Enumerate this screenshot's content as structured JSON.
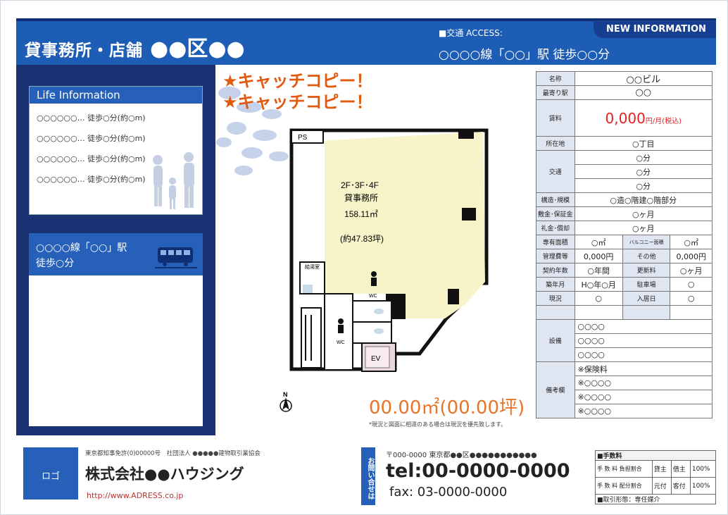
{
  "header": {
    "title": "貸事務所・店舗",
    "ward": "●●区●●",
    "access_label": "■交通 ACCESS:",
    "access_value": "○○○○線「○○」駅 徒歩○○分",
    "new_info": "NEW INFORMATION"
  },
  "life": {
    "title": "Life Information",
    "items": [
      "○○○○○○…  徒歩○分(約○m)",
      "○○○○○○…  徒歩○分(約○m)",
      "○○○○○○…  徒歩○分(約○m)",
      "○○○○○○…  徒歩○分(約○m)"
    ]
  },
  "access_box": {
    "line1": "○○○○線「○○」駅",
    "line2": "徒歩○分"
  },
  "catchcopy": [
    "★キャッチコピー！",
    "★キャッチコピー！"
  ],
  "floorplan": {
    "ps": "PS",
    "floors": "2F･3F･4F",
    "use": "貸事務所",
    "area": "158.11㎡",
    "tsubo": "(約47.83坪)",
    "kyuto": "給湯室",
    "wc": "WC",
    "ev": "EV",
    "north": "N"
  },
  "area_price": "00.00㎡(00.00坪)",
  "note": "*現況と図面に相違のある場合は現況を優先致します。",
  "spec": {
    "name_k": "名称",
    "name_v": "○○ビル",
    "station_k": "最寄り駅",
    "station_v": "○○",
    "rent_k": "賃料",
    "rent_v": "0,000",
    "rent_unit": "円/月(税込)",
    "loc_k": "所在地",
    "loc_v": "○丁目",
    "transit_k": "交通",
    "transit_v": [
      "○分",
      "○分",
      "○分"
    ],
    "struct_k": "構造･規模",
    "struct_v": "○造○階建○階部分",
    "deposit_k": "敷金･保証金",
    "deposit_v": "○ヶ月",
    "key_k": "礼金･償却",
    "key_v": "○ヶ月",
    "exclusive_k": "専有面積",
    "exclusive_v": "○㎡",
    "balcony_k": "バルコニー面積",
    "balcony_v": "○㎡",
    "mgmt_k": "管理費等",
    "mgmt_v": "0,000円",
    "other_k": "その他",
    "other_v": "0,000円",
    "term_k": "契約年数",
    "term_v": "○年間",
    "renew_k": "更新料",
    "renew_v": "○ヶ月",
    "built_k": "築年月",
    "built_v": "H○年○月",
    "parking_k": "駐車場",
    "parking_v": "○",
    "status_k": "現況",
    "status_v": "○",
    "move_k": "入居日",
    "move_v": "○",
    "equip_k": "設備",
    "equip_v": [
      "○○○○",
      "○○○○",
      "○○○○"
    ],
    "remarks_k": "備考欄",
    "remarks_v": [
      "※保険料",
      "※○○○○",
      "※○○○○",
      "※○○○○"
    ]
  },
  "footer": {
    "logo": "ロゴ",
    "license": "東京都知事免許(0)00000号　社団法人 ●●●●●建物取引業協会",
    "company": "株式会社●●ハウジング",
    "url": "http://www.ADRESS.co.jp",
    "inquiry": "お問い合せは",
    "address": "〒000-0000 東京都●●区●●●●●●●●●●●",
    "tel": "tel:00-0000-0000",
    "fax": "fax: 03-0000-0000"
  },
  "fee": {
    "title": "■手数料",
    "r1a": "手 数 料 負担割合",
    "r1b": "貸主",
    "r1c": "借主",
    "r1d": "100%",
    "r2a": "手 数 料 配分割合",
    "r2b": "元付",
    "r2c": "客付",
    "r2d": "100%",
    "form": "■取引形態：専任媒介"
  },
  "colors": {
    "brand": "#1e5db5",
    "navy": "#1a3173",
    "accent": "#e05a10",
    "red": "#e51f1f",
    "floor": "#f6f4c8"
  }
}
